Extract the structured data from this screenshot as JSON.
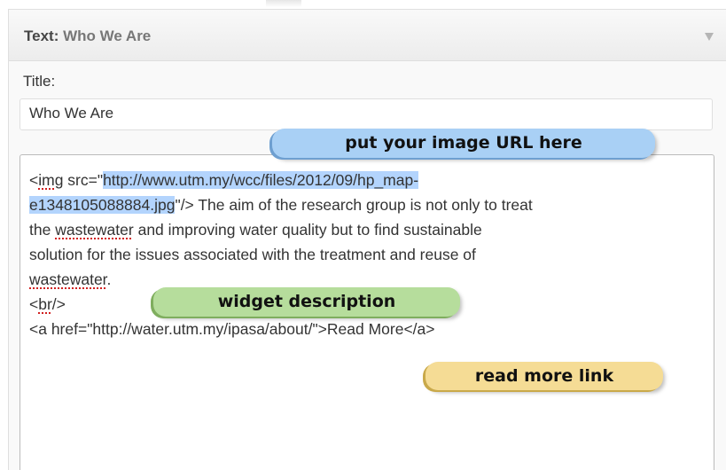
{
  "widget": {
    "header_prefix": "Text:",
    "header_name": "Who We Are",
    "title_label": "Title:",
    "title_value": "Who We Are"
  },
  "textarea": {
    "line1_a": "<",
    "line1_img": "img",
    "line1_b": " src=\"",
    "line1_url": "http://www.utm.my/wcc/files/2012/09/hp_map-",
    "line2_url": "e1348105088884.jpg",
    "line2_b": "\"/> The aim of the research group is not only to treat",
    "line3_a": "the ",
    "line3_word": "wastewater",
    "line3_b": " and improving water quality but to find sustainable",
    "line4": "solution for the issues associated with the treatment and reuse of",
    "line5_word": "wastewater",
    "line5_b": ".",
    "line6_a": "<",
    "line6_br": "br",
    "line6_b": "/>",
    "line7": "<a href=\"http://water.utm.my/ipasa/about/\">Read More</a>"
  },
  "callouts": {
    "image_url": "put your image URL here",
    "description": "widget description",
    "read_more": "read more link"
  },
  "colors": {
    "selection": "#b3d4fd",
    "callout_blue": "#a9d0f5",
    "callout_green": "#b6dd9c",
    "callout_yellow": "#f5dc95",
    "spellcheck": "#d11f1f"
  },
  "icons": {
    "collapse": "triangle-down"
  }
}
